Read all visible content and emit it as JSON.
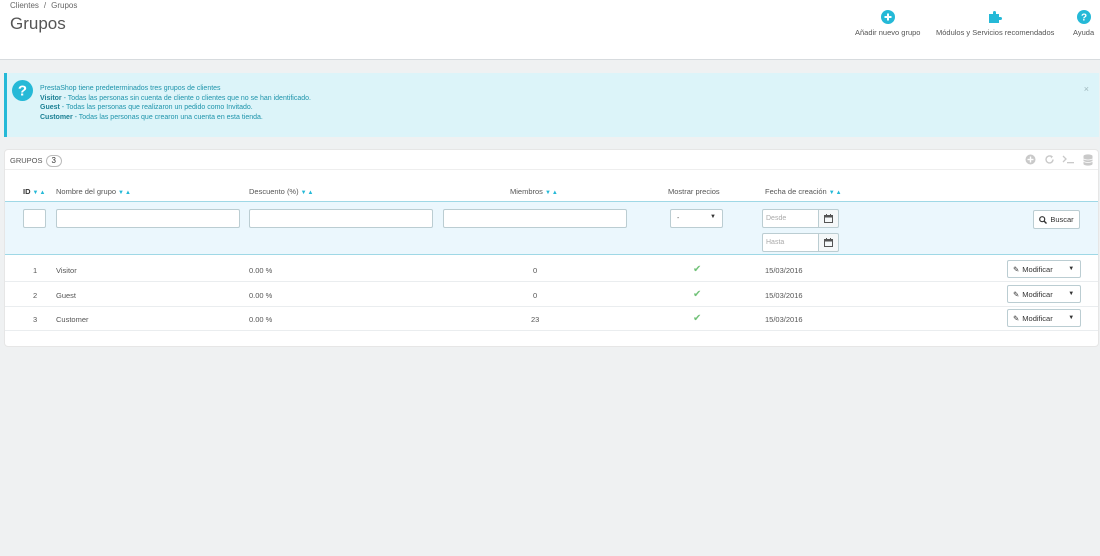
{
  "breadcrumb": {
    "parent": "Clientes",
    "separator": "/",
    "current": "Grupos"
  },
  "page_title": "Grupos",
  "toolbar": {
    "add_group": "Añadir nuevo grupo",
    "modules": "Módulos y Servicios recomendados",
    "help": "Ayuda"
  },
  "alert": {
    "intro": "PrestaShop tiene predeterminados tres grupos de clientes",
    "lines": [
      {
        "name": "Visitor",
        "text": " - Todas las personas sin cuenta de cliente o clientes que no se han identificado."
      },
      {
        "name": "Guest",
        "text": " - Todas las personas que realizaron un pedido como Invitado."
      },
      {
        "name": "Customer",
        "text": " - Todas las personas que crearon una cuenta en esta tienda."
      }
    ],
    "close": "×"
  },
  "panel": {
    "title": "Grupos",
    "count": "3"
  },
  "columns": {
    "id": "ID",
    "name": "Nombre del grupo",
    "discount": "Descuento (%)",
    "members": "Miembros",
    "show_prices": "Mostrar precios",
    "created": "Fecha de creación"
  },
  "filters": {
    "show_prices_value": "-",
    "date_from_placeholder": "Desde",
    "date_to_placeholder": "Hasta",
    "search_label": "Buscar"
  },
  "rows": [
    {
      "id": "1",
      "name": "Visitor",
      "discount": "0.00 %",
      "members": "0",
      "show_prices": true,
      "created": "15/03/2016",
      "action": "Modificar"
    },
    {
      "id": "2",
      "name": "Guest",
      "discount": "0.00 %",
      "members": "0",
      "show_prices": true,
      "created": "15/03/2016",
      "action": "Modificar"
    },
    {
      "id": "3",
      "name": "Customer",
      "discount": "0.00 %",
      "members": "23",
      "show_prices": true,
      "created": "15/03/2016",
      "action": "Modificar"
    }
  ],
  "colors": {
    "accent": "#25b9d7",
    "success": "#72c279",
    "alert_bg": "#dcf4f9"
  }
}
